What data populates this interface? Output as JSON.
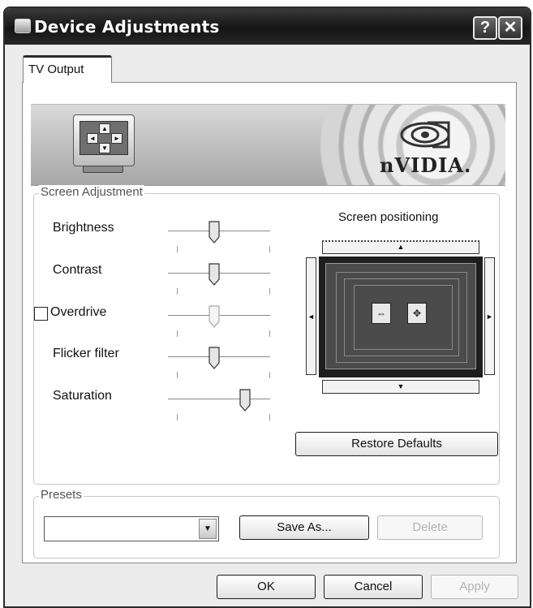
{
  "window": {
    "title": "Device Adjustments",
    "help_label": "?",
    "close_label": "✕"
  },
  "tabs": [
    {
      "label": "TV Output"
    }
  ],
  "banner": {
    "logo_text": "nVIDIA."
  },
  "screen_adjustment": {
    "group_label": "Screen Adjustment",
    "sliders": [
      {
        "label": "Brightness",
        "value": 0.45
      },
      {
        "label": "Contrast",
        "value": 0.45
      },
      {
        "label": "Overdrive",
        "value": 0.45,
        "disabled": true,
        "checked": false
      },
      {
        "label": "Flicker filter",
        "value": 0.45
      },
      {
        "label": "Saturation",
        "value": 0.75
      }
    ],
    "positioning_label": "Screen positioning",
    "restore_label": "Restore Defaults"
  },
  "presets": {
    "group_label": "Presets",
    "selected": "",
    "save_as_label": "Save As...",
    "delete_label": "Delete"
  },
  "footer": {
    "ok_label": "OK",
    "cancel_label": "Cancel",
    "apply_label": "Apply"
  }
}
